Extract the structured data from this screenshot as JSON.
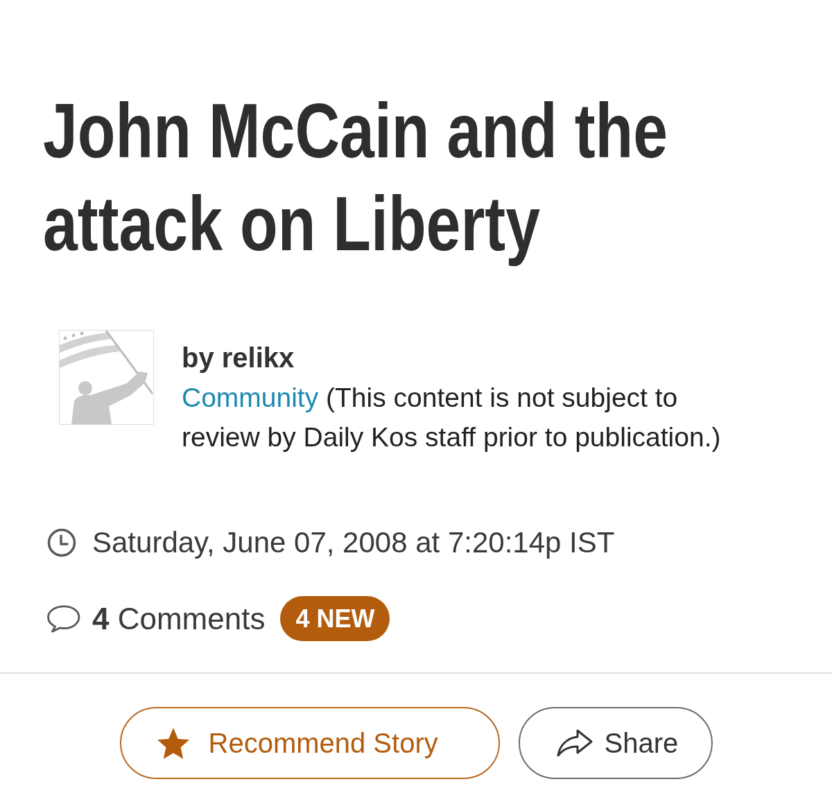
{
  "article": {
    "title": "John McCain and the attack on Liberty"
  },
  "byline": {
    "author": "by relikx",
    "category_link": "Community",
    "note": "(This content is not subject to review by Daily Kos staff prior to publication.)"
  },
  "timestamp": "Saturday, June 07, 2008 at 7:20:14p IST",
  "comments": {
    "text": "**4** Comments",
    "badge": "4 NEW"
  },
  "actions": [
    {
      "kind": "recommend",
      "label": "Recommend Story"
    },
    {
      "kind": "share",
      "label": "Share"
    }
  ]
}
